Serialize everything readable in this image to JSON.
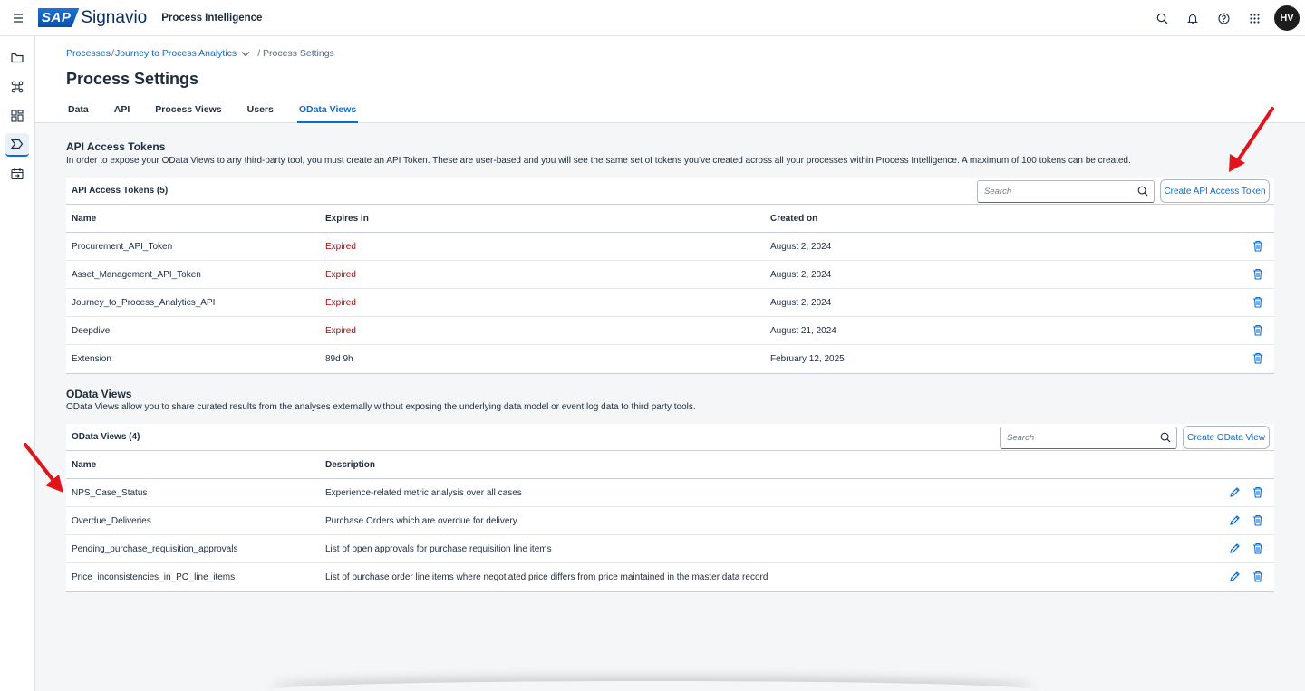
{
  "shell": {
    "brand_sap": "SAP",
    "brand_name": "Signavio",
    "product": "Process Intelligence",
    "avatar_initials": "HV"
  },
  "breadcrumb": {
    "link1": "Processes",
    "sep1": "/",
    "link2": "Journey to Process Analytics",
    "current": "/ Process Settings"
  },
  "page_title": "Process Settings",
  "tabs": [
    {
      "label": "Data"
    },
    {
      "label": "API"
    },
    {
      "label": "Process Views"
    },
    {
      "label": "Users"
    },
    {
      "label": "OData Views",
      "active": true
    }
  ],
  "tokens_section": {
    "title": "API Access Tokens",
    "description": "In order to expose your OData Views to any third-party tool, you must create an API Token. These are user-based and you will see the same set of tokens you've created across all your processes within Process Intelligence. A maximum of 100 tokens can be created.",
    "table_title": "API Access Tokens (5)",
    "search_placeholder": "Search",
    "create_button": "Create API Access Token",
    "columns": [
      "Name",
      "Expires in",
      "Created on"
    ],
    "rows": [
      {
        "name": "Procurement_API_Token",
        "expires": "Expired",
        "created": "August 2, 2024"
      },
      {
        "name": "Asset_Management_API_Token",
        "expires": "Expired",
        "created": "August 2, 2024"
      },
      {
        "name": "Journey_to_Process_Analytics_API",
        "expires": "Expired",
        "created": "August 2, 2024"
      },
      {
        "name": "Deepdive",
        "expires": "Expired",
        "created": "August 21, 2024"
      },
      {
        "name": "Extension",
        "expires": "89d 9h",
        "created": "February 12, 2025"
      }
    ]
  },
  "odata_section": {
    "title": "OData Views",
    "description": "OData Views allow you to share curated results from the analyses externally without exposing the underlying data model or event log data to third party tools.",
    "table_title": "OData Views (4)",
    "search_placeholder": "Search",
    "create_button": "Create OData View",
    "columns": [
      "Name",
      "Description"
    ],
    "rows": [
      {
        "name": "NPS_Case_Status",
        "description": "Experience-related metric analysis over all cases"
      },
      {
        "name": "Overdue_Deliveries",
        "description": "Purchase Orders which are overdue for delivery"
      },
      {
        "name": "Pending_purchase_requisition_approvals",
        "description": "List of open approvals for purchase requisition line items"
      },
      {
        "name": "Price_inconsistencies_in_PO_line_items",
        "description": "List of purchase order line items where negotiated price differs from price maintained in the master data record"
      }
    ]
  },
  "colors": {
    "accent": "#0a6ed1",
    "expired": "#aa0808",
    "annotation_arrow": "#e0141a"
  },
  "icons": [
    "menu-icon",
    "search-icon",
    "bell-icon",
    "help-icon",
    "apps-grid-icon",
    "folder-icon",
    "model-icon",
    "dashboard-icon",
    "process-icon",
    "calendar-icon",
    "chevron-down-icon",
    "trash-icon",
    "edit-icon"
  ]
}
